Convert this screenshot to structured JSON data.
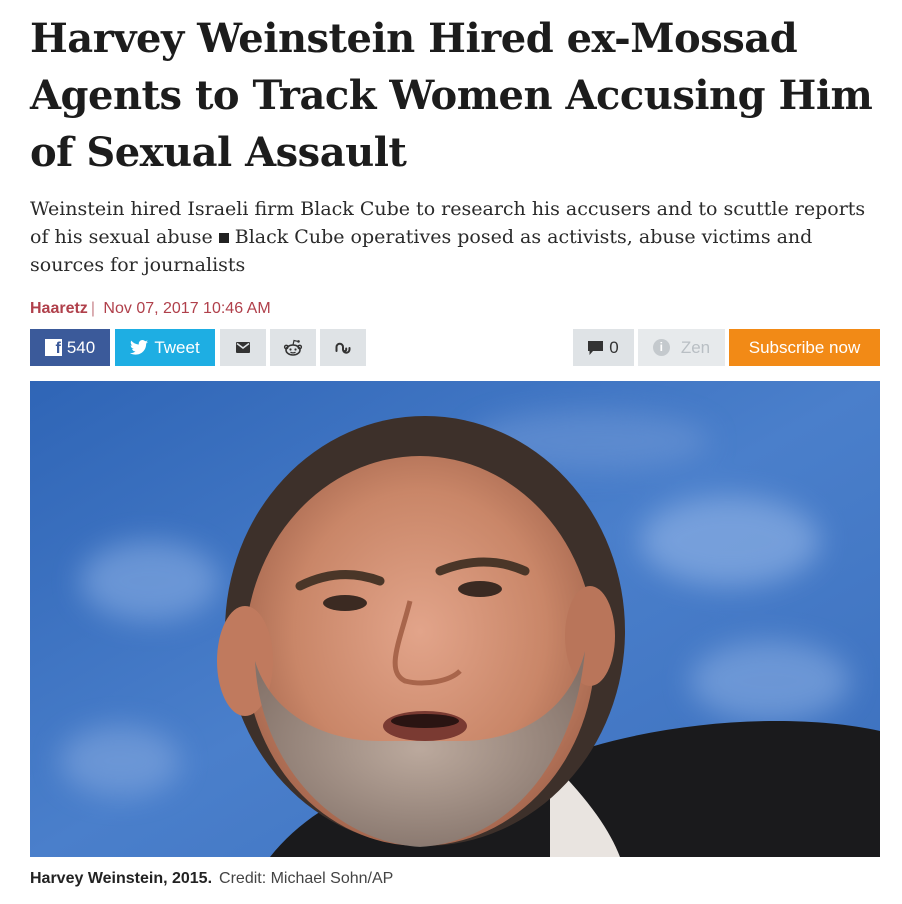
{
  "article": {
    "headline": "Harvey Weinstein Hired ex-Mossad Agents to Track Women Accusing Him of Sexual Assault",
    "subhead_part1": "Weinstein hired Israeli firm Black Cube to research his accusers and to scuttle reports of his sexual abuse",
    "subhead_part2": "Black Cube operatives posed as activists, abuse victims and sources for journalists",
    "author": "Haaretz",
    "date": "Nov 07, 2017 10:46 AM"
  },
  "share": {
    "facebook_count": "540",
    "tweet_label": "Tweet",
    "comments_count": "0",
    "zen_label": "Zen",
    "subscribe_label": "Subscribe now"
  },
  "icons": {
    "facebook": "facebook-icon",
    "twitter": "twitter-bird-icon",
    "email": "envelope-icon",
    "reddit": "reddit-icon",
    "stumbleupon": "stumbleupon-icon",
    "comment": "speech-bubble-icon",
    "zen": "info-circle-icon"
  },
  "colors": {
    "facebook": "#3b5a9a",
    "twitter": "#1eaee3",
    "subscribe": "#f28a16",
    "byline": "#b0404b"
  },
  "photo": {
    "caption_name": "Harvey Weinstein, 2015.",
    "caption_credit": "Credit: Michael Sohn/AP"
  }
}
